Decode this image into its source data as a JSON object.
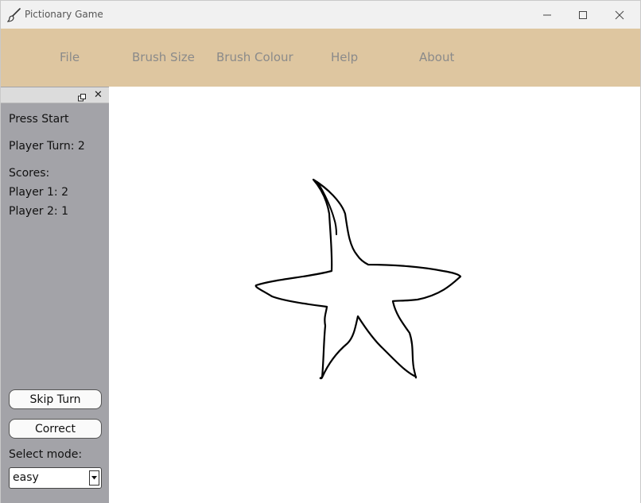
{
  "window": {
    "title": "Pictionary Game",
    "icon": "paintbrush-icon",
    "controls": [
      "minimize-icon",
      "maximize-icon",
      "close-icon"
    ]
  },
  "menubar": {
    "background": "#dec6a0",
    "items": [
      "File",
      "Brush Size",
      "Brush Colour",
      "Help",
      "About"
    ]
  },
  "panel": {
    "status": "Press Start",
    "player_turn": "Player Turn: 2",
    "scores_label": "Scores:",
    "scores": [
      "Player 1: 2",
      "Player 2: 1"
    ],
    "skip_label": "Skip Turn",
    "correct_label": "Correct",
    "mode_label": "Select mode:",
    "mode_value": "easy",
    "close_glyph": "✕"
  },
  "canvas": {
    "drawing": "starfish-sketch",
    "brush_color": "#000000"
  }
}
